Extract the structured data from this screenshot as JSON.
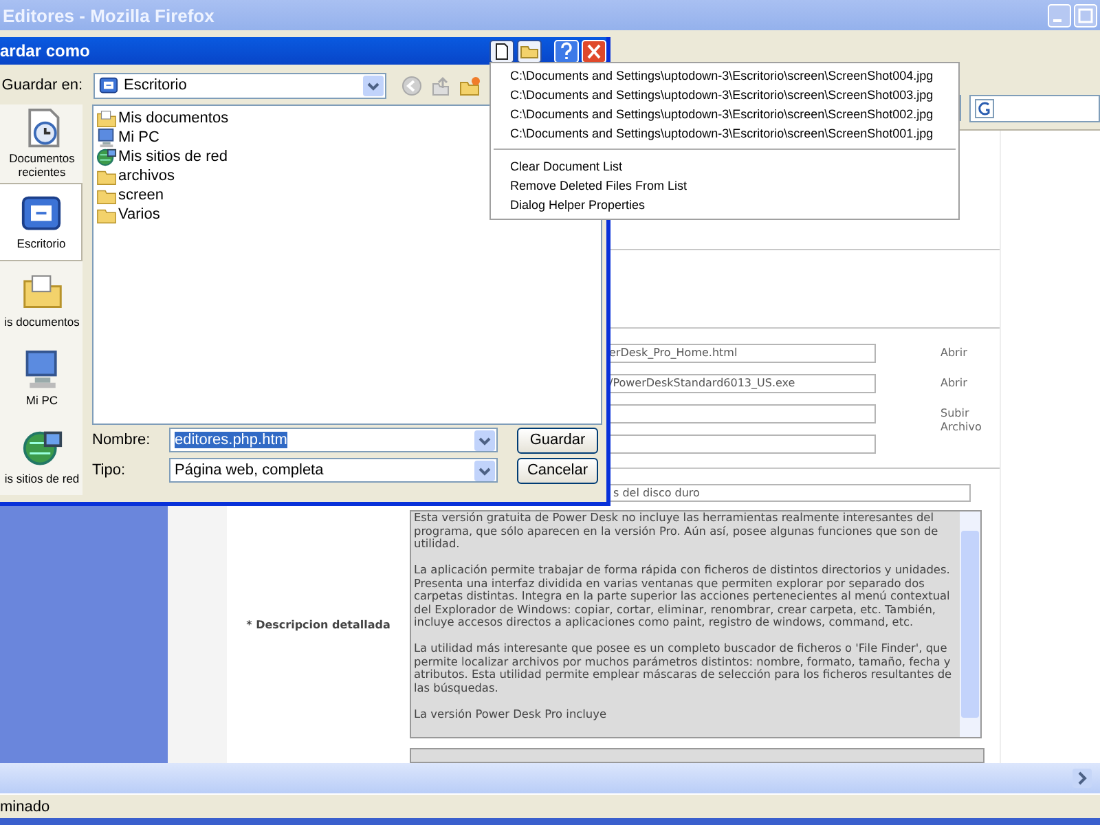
{
  "window": {
    "title": "Editores - Mozilla Firefox"
  },
  "page": {
    "fields": [
      {
        "kind": "text",
        "value": "erDesk_Pro_Home.html",
        "action": "Abrir"
      },
      {
        "kind": "text",
        "value": "/PowerDeskStandard6013_US.exe",
        "action": "Abrir"
      },
      {
        "kind": "text",
        "action": "Subir Archivo"
      },
      {
        "kind": "text"
      }
    ],
    "short_field": "s del disco duro",
    "description_label": "* Descripcion detallada",
    "description": [
      "Esta versión gratuita de Power Desk no incluye las herramientas realmente interesantes del programa, que sólo aparecen en la versión Pro. Aún así, posee algunas funciones que son de utilidad.",
      "La aplicación permite trabajar de forma rápida con ficheros de distintos directorios y unidades. Presenta una interfaz dividida en varias ventanas que permiten explorar por separado dos carpetas distintas. Integra en la parte superior las acciones pertenecientes al menú contextual del Explorador de Windows: copiar, cortar, eliminar, renombrar, crear carpeta, etc. También, incluye accesos directos a aplicaciones como paint, registro de windows, command, etc.",
      "La utilidad más interesante que posee es un completo buscador de ficheros o 'File Finder', que permite localizar archivos por muchos parámetros distintos: nombre, formato, tamaño, fecha y atributos. Esta utilidad permite emplear máscaras de selección para los ficheros resultantes de las búsquedas.",
      "La versión Power Desk Pro incluye "
    ]
  },
  "status_bar": "minado",
  "dialog": {
    "title": "ardar como",
    "save_in_label": "Guardar en:",
    "save_in": "Escritorio",
    "places": [
      {
        "label": "Documentos recientes",
        "kind": "recent",
        "selected": false
      },
      {
        "label": "Escritorio",
        "kind": "desktop",
        "selected": true
      },
      {
        "label": "is documentos",
        "kind": "docs",
        "selected": false
      },
      {
        "label": "Mi PC",
        "kind": "computer",
        "selected": false
      },
      {
        "label": "is sitios de red",
        "kind": "network",
        "selected": false
      }
    ],
    "files": [
      {
        "name": "Mis documentos",
        "kind": "docs"
      },
      {
        "name": "Mi PC",
        "kind": "computer"
      },
      {
        "name": "Mis sitios de red",
        "kind": "network"
      },
      {
        "name": "archivos",
        "kind": "folder"
      },
      {
        "name": "screen",
        "kind": "folder"
      },
      {
        "name": "Varios",
        "kind": "folder"
      }
    ],
    "name_label": "Nombre:",
    "name_value": "editores.php.htm",
    "type_label": "Tipo:",
    "type_value": "Página web, completa",
    "save_button": "Guardar",
    "cancel_button": "Cancelar"
  },
  "menu": {
    "recent": [
      "C:\\Documents and Settings\\uptodown-3\\Escritorio\\screen\\ScreenShot004.jpg",
      "C:\\Documents and Settings\\uptodown-3\\Escritorio\\screen\\ScreenShot003.jpg",
      "C:\\Documents and Settings\\uptodown-3\\Escritorio\\screen\\ScreenShot002.jpg",
      "C:\\Documents and Settings\\uptodown-3\\Escritorio\\screen\\ScreenShot001.jpg"
    ],
    "actions": [
      "Clear Document List",
      "Remove Deleted Files From List",
      "Dialog Helper Properties"
    ]
  }
}
